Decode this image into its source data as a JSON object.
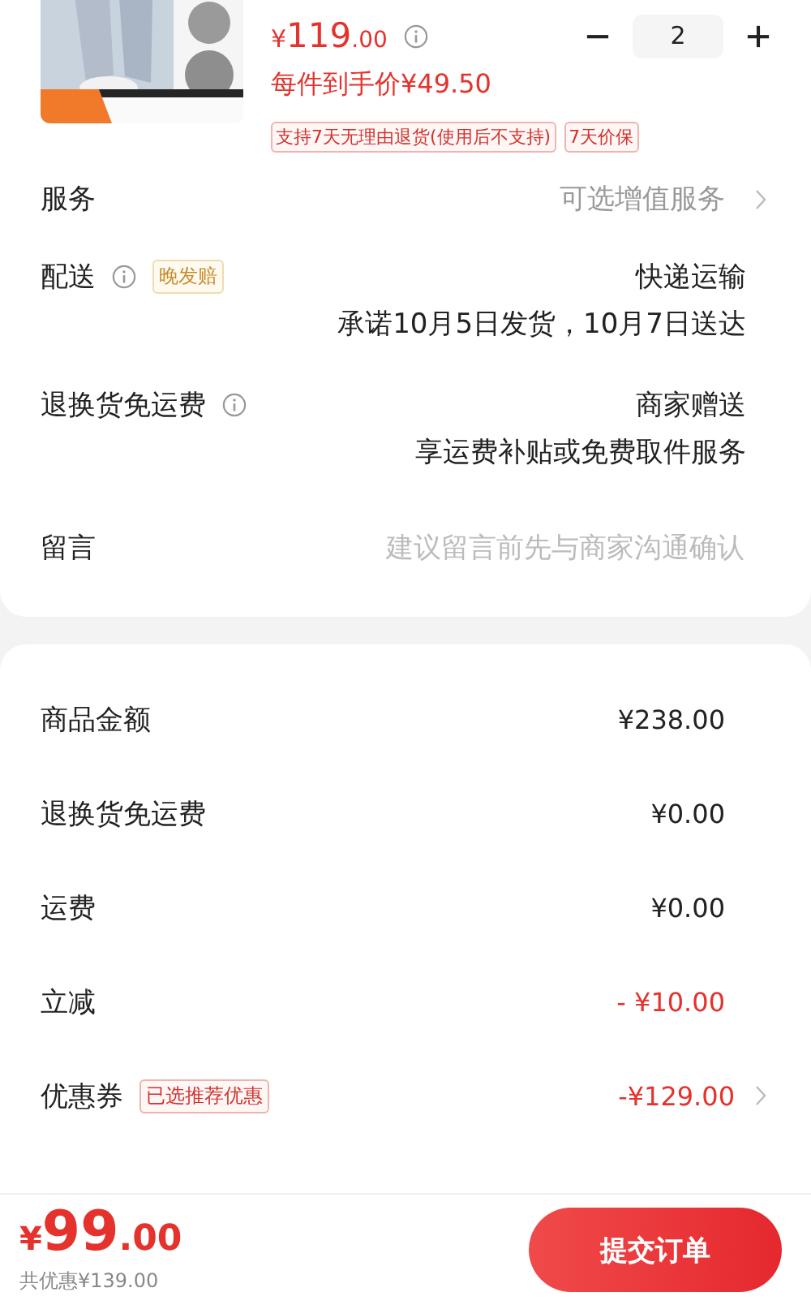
{
  "product": {
    "price": {
      "symbol": "¥",
      "integer": "119",
      "fraction": ".00"
    },
    "quantity": "2",
    "per_item": "每件到手价¥49.50",
    "tags": [
      "支持7天无理由退货(使用后不支持)",
      "7天价保"
    ]
  },
  "options": [
    {
      "kind": "link",
      "label": "服务",
      "value": "可选增值服务"
    },
    {
      "kind": "info",
      "label": "配送",
      "badge": "晚发赔",
      "lines": [
        "快递运输",
        "承诺10月5日发货，10月7日送达"
      ]
    },
    {
      "kind": "info",
      "label": "退换货免运费",
      "lines": [
        "商家赠送",
        "享运费补贴或免费取件服务"
      ]
    },
    {
      "kind": "input",
      "label": "留言",
      "placeholder": "建议留言前先与商家沟通确认"
    }
  ],
  "summary": [
    {
      "kind": "plain",
      "label": "商品金额",
      "value": "¥238.00"
    },
    {
      "kind": "plain",
      "label": "退换货免运费",
      "value": "¥0.00"
    },
    {
      "kind": "plain",
      "label": "运费",
      "value": "¥0.00"
    },
    {
      "kind": "discount",
      "label": "立减",
      "value": "- ¥10.00"
    },
    {
      "kind": "coupon",
      "label": "优惠券",
      "badge": "已选推荐优惠",
      "value": "-¥129.00"
    }
  ],
  "footer": {
    "total": {
      "symbol": "¥",
      "integer": "99",
      "fraction": ".00"
    },
    "saved": "共优惠¥139.00",
    "submit": "提交订单"
  }
}
